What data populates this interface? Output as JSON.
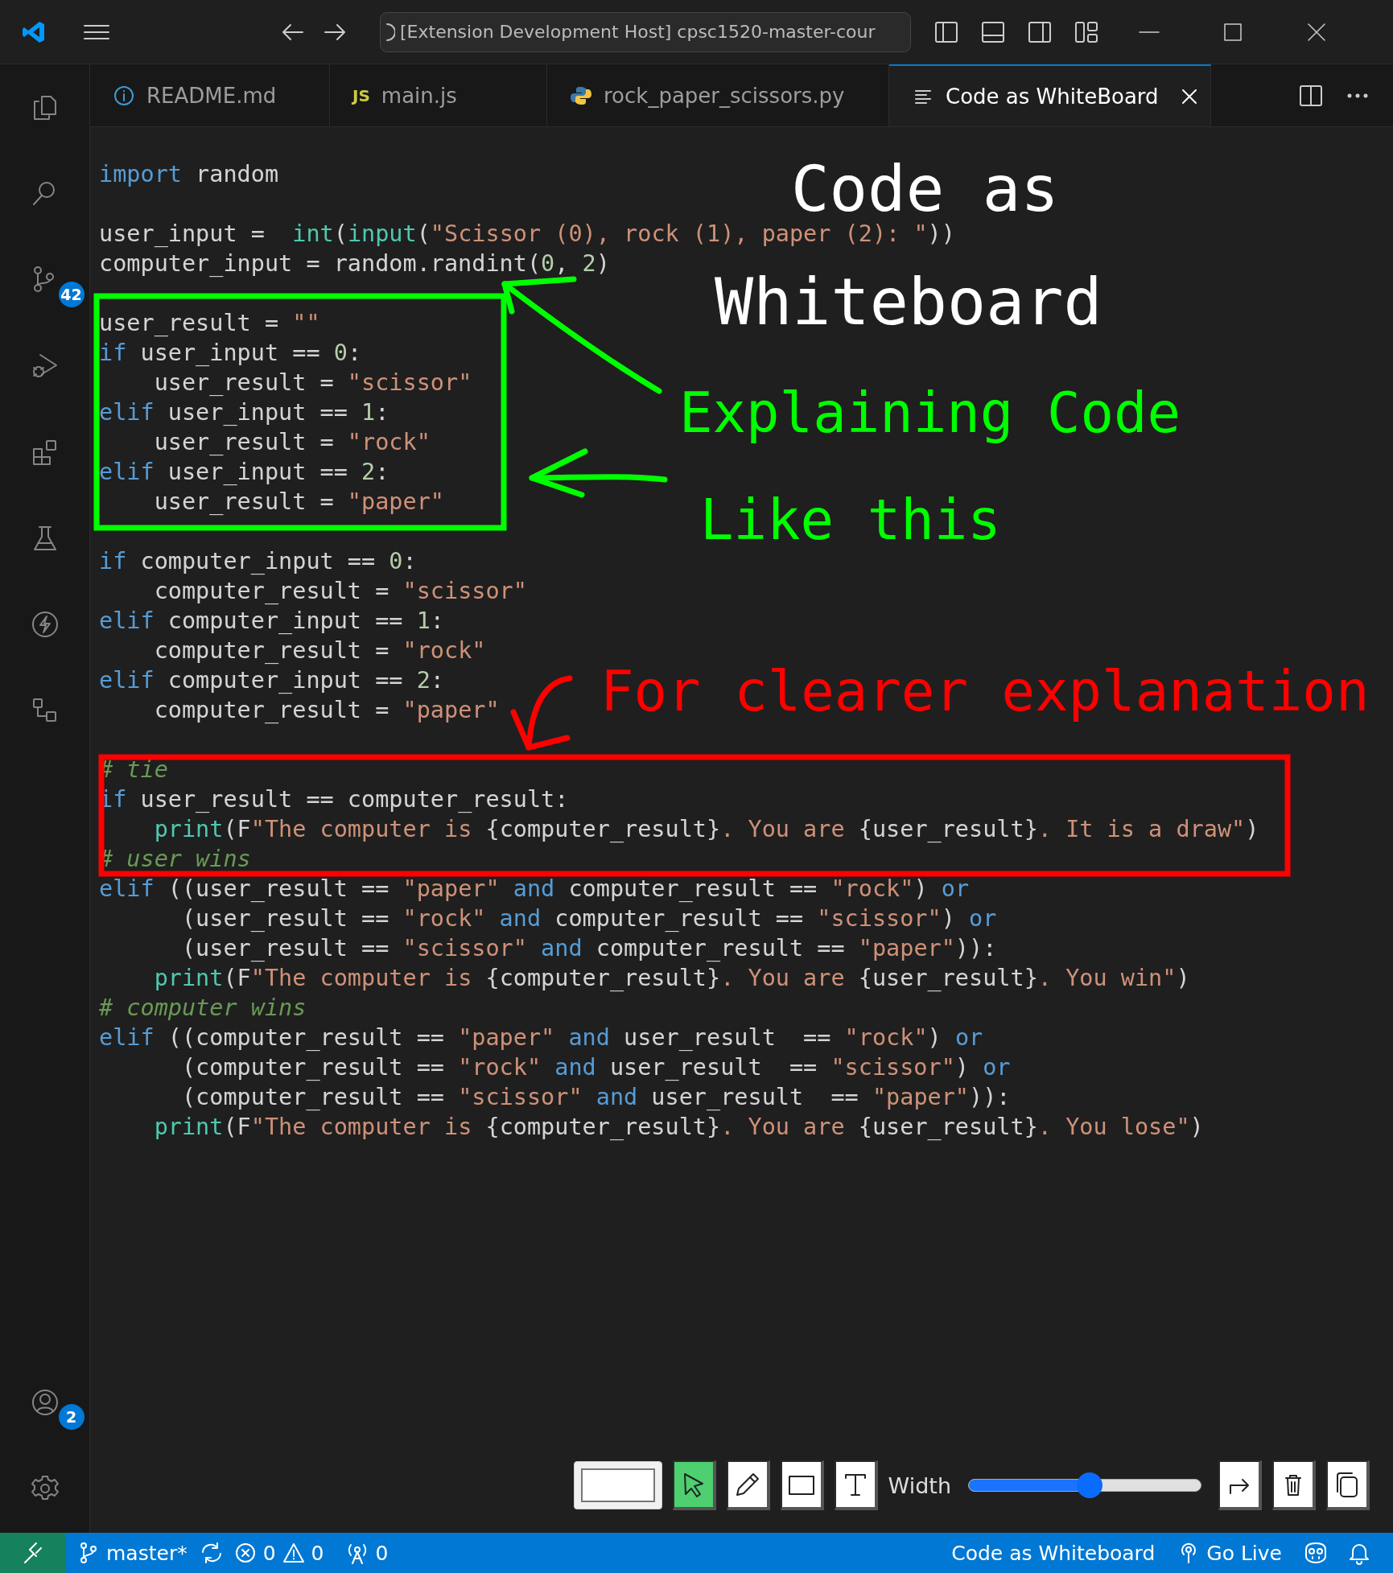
{
  "title_bar": {
    "search_text": "[Extension Development Host] cpsc1520-master-cour"
  },
  "activity_bar": {
    "items": [
      {
        "kind": "files"
      },
      {
        "kind": "search"
      },
      {
        "kind": "source-control",
        "badge": "42"
      },
      {
        "kind": "run"
      },
      {
        "kind": "extensions"
      },
      {
        "kind": "testing"
      },
      {
        "kind": "lightning"
      },
      {
        "kind": "tree"
      }
    ],
    "bottom_items": [
      {
        "kind": "accounts",
        "badge": "2"
      },
      {
        "kind": "settings"
      }
    ]
  },
  "tabs": [
    {
      "label": "README.md",
      "kind": "info",
      "selected": false,
      "closable": false
    },
    {
      "label": "main.js",
      "kind": "js",
      "icon_text": "JS",
      "selected": false,
      "closable": false
    },
    {
      "label": "rock_paper_scissors.py",
      "kind": "python",
      "selected": false,
      "closable": false
    },
    {
      "label": "Code as WhiteBoard",
      "kind": "lines",
      "selected": true,
      "closable": true
    }
  ],
  "code_blocks": [
    [
      [
        {
          "kw": "import"
        },
        {
          "tx": " random"
        }
      ]
    ],
    [
      [
        {
          "tx": "user_input =  "
        },
        {
          "fn": "int"
        },
        {
          "tx": "("
        },
        {
          "fn": "input"
        },
        {
          "tx": "("
        },
        {
          "str": "\"Scissor (0), rock (1), paper (2): \""
        },
        {
          "tx": "))"
        }
      ],
      [
        {
          "tx": "computer_input = random.randint("
        },
        {
          "num": "0"
        },
        {
          "tx": ", "
        },
        {
          "num": "2"
        },
        {
          "tx": ")"
        }
      ]
    ],
    [
      [
        {
          "tx": "user_result = "
        },
        {
          "str": "\"\""
        }
      ],
      [
        {
          "kw": "if"
        },
        {
          "tx": " user_input == "
        },
        {
          "num": "0"
        },
        {
          "tx": ":"
        }
      ],
      [
        {
          "tx": "    user_result = "
        },
        {
          "str": "\"scissor\""
        }
      ],
      [
        {
          "kw": "elif"
        },
        {
          "tx": " user_input == "
        },
        {
          "num": "1"
        },
        {
          "tx": ":"
        }
      ],
      [
        {
          "tx": "    user_result = "
        },
        {
          "str": "\"rock\""
        }
      ],
      [
        {
          "kw": "elif"
        },
        {
          "tx": " user_input == "
        },
        {
          "num": "2"
        },
        {
          "tx": ":"
        }
      ],
      [
        {
          "tx": "    user_result = "
        },
        {
          "str": "\"paper\""
        }
      ]
    ],
    [
      [
        {
          "kw": "if"
        },
        {
          "tx": " computer_input == "
        },
        {
          "num": "0"
        },
        {
          "tx": ":"
        }
      ],
      [
        {
          "tx": "    computer_result = "
        },
        {
          "str": "\"scissor\""
        }
      ],
      [
        {
          "kw": "elif"
        },
        {
          "tx": " computer_input == "
        },
        {
          "num": "1"
        },
        {
          "tx": ":"
        }
      ],
      [
        {
          "tx": "    computer_result = "
        },
        {
          "str": "\"rock\""
        }
      ],
      [
        {
          "kw": "elif"
        },
        {
          "tx": " computer_input == "
        },
        {
          "num": "2"
        },
        {
          "tx": ":"
        }
      ],
      [
        {
          "tx": "    computer_result = "
        },
        {
          "str": "\"paper\""
        }
      ]
    ],
    [
      [
        {
          "cm": "# tie"
        }
      ],
      [
        {
          "kw": "if"
        },
        {
          "tx": " user_result == computer_result:"
        }
      ],
      [
        {
          "fn": "    print"
        },
        {
          "tx": "(F"
        },
        {
          "str": "\"The computer is "
        },
        {
          "tx": "{computer_result}"
        },
        {
          "str": ". You are "
        },
        {
          "tx": "{user_result}"
        },
        {
          "str": ". It is a draw\""
        },
        {
          "tx": ")"
        }
      ],
      [
        {
          "cm": "# user wins"
        }
      ],
      [
        {
          "kw": "elif"
        },
        {
          "tx": " ((user_result == "
        },
        {
          "str": "\"paper\" "
        },
        {
          "kw": "and"
        },
        {
          "tx": " computer_result == "
        },
        {
          "str": "\"rock\""
        },
        {
          "tx": ") "
        },
        {
          "kw": "or"
        }
      ],
      [
        {
          "tx": "      (user_result == "
        },
        {
          "str": "\"rock\" "
        },
        {
          "kw": "and"
        },
        {
          "tx": " computer_result == "
        },
        {
          "str": "\"scissor\""
        },
        {
          "tx": ") "
        },
        {
          "kw": "or"
        }
      ],
      [
        {
          "tx": "      (user_result == "
        },
        {
          "str": "\"scissor\" "
        },
        {
          "kw": "and"
        },
        {
          "tx": " computer_result == "
        },
        {
          "str": "\"paper\""
        },
        {
          "tx": ")):"
        }
      ],
      [
        {
          "fn": "    print"
        },
        {
          "tx": "(F"
        },
        {
          "str": "\"The computer is "
        },
        {
          "tx": "{computer_result}"
        },
        {
          "str": ". You are "
        },
        {
          "tx": "{user_result}"
        },
        {
          "str": ". You win\""
        },
        {
          "tx": ")"
        }
      ],
      [
        {
          "cm": "# computer wins"
        }
      ],
      [
        {
          "kw": "elif"
        },
        {
          "tx": " ((computer_result == "
        },
        {
          "str": "\"paper\" "
        },
        {
          "kw": "and"
        },
        {
          "tx": " user_result  == "
        },
        {
          "str": "\"rock\""
        },
        {
          "tx": ") "
        },
        {
          "kw": "or"
        }
      ],
      [
        {
          "tx": "      (computer_result == "
        },
        {
          "str": "\"rock\" "
        },
        {
          "kw": "and"
        },
        {
          "tx": " user_result  == "
        },
        {
          "str": "\"scissor\""
        },
        {
          "tx": ") "
        },
        {
          "kw": "or"
        }
      ],
      [
        {
          "tx": "      (computer_result == "
        },
        {
          "str": "\"scissor\" "
        },
        {
          "kw": "and"
        },
        {
          "tx": " user_result  == "
        },
        {
          "str": "\"paper\""
        },
        {
          "tx": ")):"
        }
      ],
      [
        {
          "fn": "    print"
        },
        {
          "tx": "(F"
        },
        {
          "str": "\"The computer is "
        },
        {
          "tx": "{computer_result}"
        },
        {
          "str": ". You are "
        },
        {
          "tx": "{user_result}"
        },
        {
          "str": ". You lose\""
        },
        {
          "tx": ")"
        }
      ]
    ]
  ],
  "annotations": [
    {
      "text": "Code as",
      "color": "#ffffff"
    },
    {
      "text": "Whiteboard",
      "color": "#ffffff"
    },
    {
      "text": "Explaining Code",
      "color": "#00ff00"
    },
    {
      "text": "Like this",
      "color": "#00ff00"
    },
    {
      "text": "For clearer explanation",
      "color": "#ff0000"
    }
  ],
  "drawings": [
    {
      "kind": "box",
      "color": "#00ff00"
    },
    {
      "kind": "arrow",
      "color": "#00ff00"
    },
    {
      "kind": "arrow",
      "color": "#00ff00"
    },
    {
      "kind": "arrow",
      "color": "#ff0000"
    },
    {
      "kind": "box",
      "color": "#ff0000"
    }
  ],
  "whiteboard_toolbar": {
    "tools": [
      {
        "kind": "select",
        "selected": true
      },
      {
        "kind": "pen",
        "selected": false
      },
      {
        "kind": "rectangle",
        "selected": false
      },
      {
        "kind": "text",
        "selected": false
      }
    ],
    "width_label": "Width",
    "width_slider": {
      "level": 0.52
    }
  },
  "status_bar": {
    "branch": "master*",
    "errors": "0",
    "warnings": "0",
    "ports": "0",
    "right_items": [
      {
        "kind": "text",
        "label": "Code as Whiteboard"
      },
      {
        "kind": "live",
        "label": "Go Live"
      }
    ]
  }
}
